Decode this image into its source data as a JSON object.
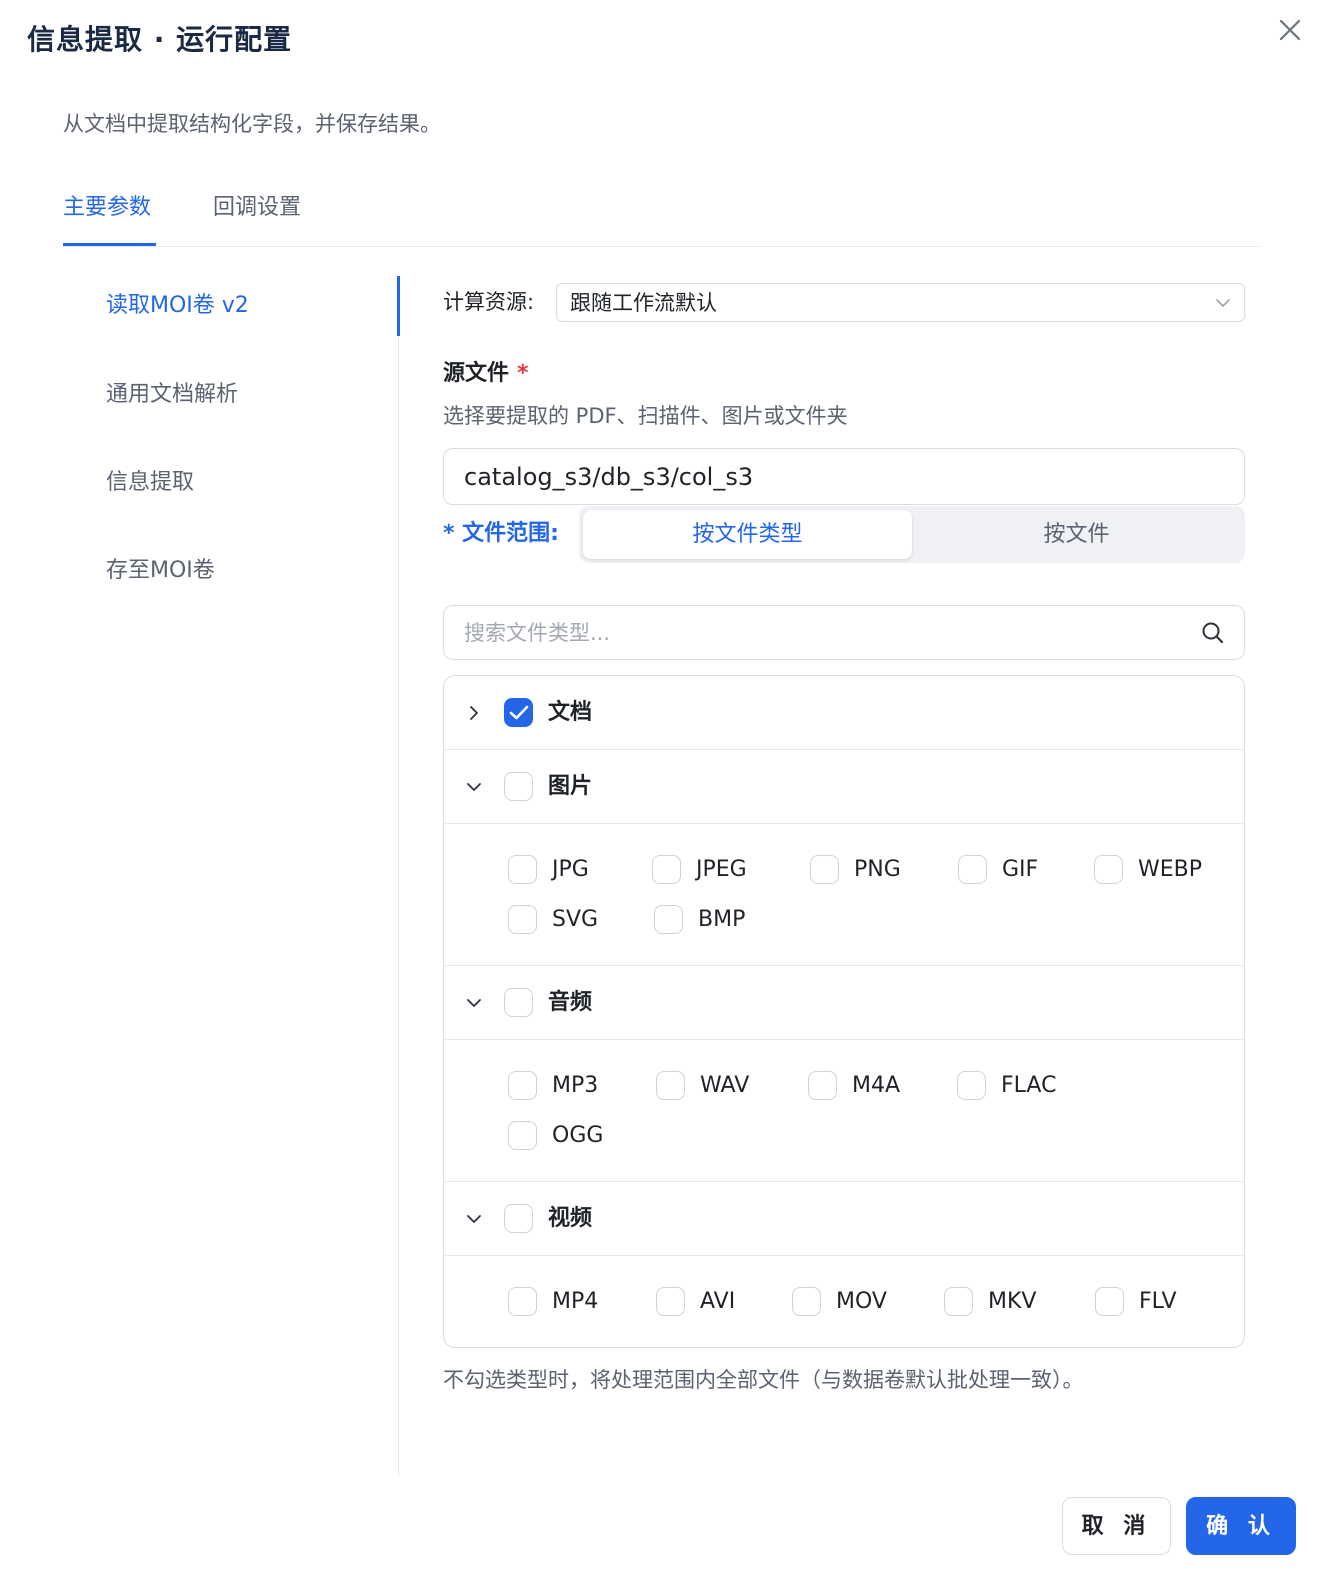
{
  "dialog": {
    "title": "信息提取 · 运行配置",
    "description": "从文档中提取结构化字段，并保存结果。",
    "close_icon": "close-icon"
  },
  "tabs": [
    {
      "label": "主要参数",
      "active": true
    },
    {
      "label": "回调设置",
      "active": false
    }
  ],
  "sidebar": {
    "items": [
      {
        "label": "读取MOI卷 v2",
        "active": true
      },
      {
        "label": "通用文档解析",
        "active": false
      },
      {
        "label": "信息提取",
        "active": false
      },
      {
        "label": "存至MOI卷",
        "active": false
      }
    ]
  },
  "form": {
    "compute_label": "计算资源:",
    "compute_value": "跟随工作流默认",
    "source_label": "源文件",
    "required_mark": "*",
    "source_help": "选择要提取的 PDF、扫描件、图片或文件夹",
    "source_value": "catalog_s3/db_s3/col_s3",
    "scope_label": "* 文件范围:",
    "scope_options": [
      "按文件类型",
      "按文件"
    ],
    "scope_selected": "按文件类型",
    "search_placeholder": "搜索文件类型...",
    "hint": "不勾选类型时，将处理范围内全部文件（与数据卷默认批处理一致）。"
  },
  "file_types": [
    {
      "name": "文档",
      "checked": true,
      "expanded": false,
      "items": []
    },
    {
      "name": "图片",
      "checked": false,
      "expanded": true,
      "items": [
        "JPG",
        "JPEG",
        "PNG",
        "GIF",
        "WEBP",
        "SVG",
        "BMP"
      ]
    },
    {
      "name": "音频",
      "checked": false,
      "expanded": true,
      "items": [
        "MP3",
        "WAV",
        "M4A",
        "FLAC",
        "OGG"
      ]
    },
    {
      "name": "视频",
      "checked": false,
      "expanded": true,
      "items": [
        "MP4",
        "AVI",
        "MOV",
        "MKV",
        "FLV"
      ]
    }
  ],
  "footer": {
    "cancel_label": "取 消",
    "confirm_label": "确 认"
  },
  "colors": {
    "accent": "#2367e8",
    "required": "#e5383b",
    "border": "#d9dce1"
  }
}
